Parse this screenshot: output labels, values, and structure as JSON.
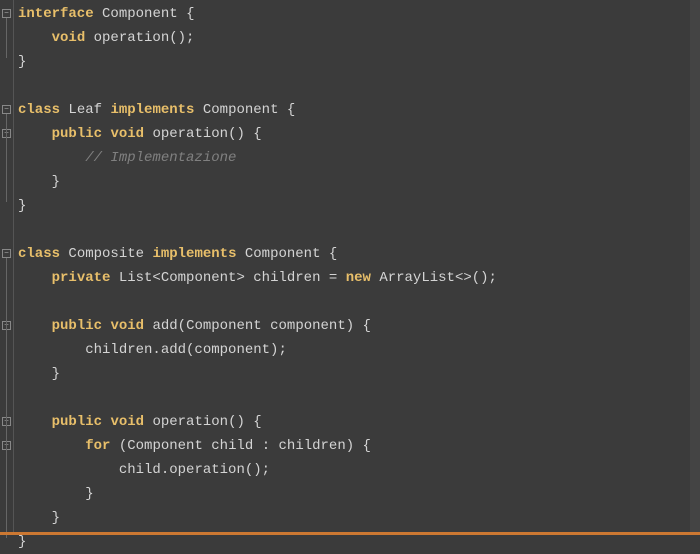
{
  "code": {
    "lines": [
      {
        "indent": 0,
        "tokens": [
          {
            "t": "kw",
            "v": "interface"
          },
          {
            "t": "sp",
            "v": " "
          },
          {
            "t": "type",
            "v": "Component"
          },
          {
            "t": "sp",
            "v": " "
          },
          {
            "t": "paren",
            "v": "{"
          }
        ]
      },
      {
        "indent": 1,
        "tokens": [
          {
            "t": "kw",
            "v": "void"
          },
          {
            "t": "sp",
            "v": " "
          },
          {
            "t": "method",
            "v": "operation"
          },
          {
            "t": "paren",
            "v": "();"
          }
        ]
      },
      {
        "indent": 0,
        "tokens": [
          {
            "t": "paren",
            "v": "}"
          }
        ]
      },
      {
        "indent": 0,
        "tokens": []
      },
      {
        "indent": 0,
        "tokens": [
          {
            "t": "kw",
            "v": "class"
          },
          {
            "t": "sp",
            "v": " "
          },
          {
            "t": "type",
            "v": "Leaf"
          },
          {
            "t": "sp",
            "v": " "
          },
          {
            "t": "kw",
            "v": "implements"
          },
          {
            "t": "sp",
            "v": " "
          },
          {
            "t": "type",
            "v": "Component"
          },
          {
            "t": "sp",
            "v": " "
          },
          {
            "t": "paren",
            "v": "{"
          }
        ]
      },
      {
        "indent": 1,
        "tokens": [
          {
            "t": "kw",
            "v": "public"
          },
          {
            "t": "sp",
            "v": " "
          },
          {
            "t": "kw",
            "v": "void"
          },
          {
            "t": "sp",
            "v": " "
          },
          {
            "t": "method",
            "v": "operation"
          },
          {
            "t": "paren",
            "v": "()"
          },
          {
            "t": "sp",
            "v": " "
          },
          {
            "t": "paren",
            "v": "{"
          }
        ]
      },
      {
        "indent": 2,
        "tokens": [
          {
            "t": "comment",
            "v": "// Implementazione"
          }
        ]
      },
      {
        "indent": 1,
        "tokens": [
          {
            "t": "paren",
            "v": "}"
          }
        ]
      },
      {
        "indent": 0,
        "tokens": [
          {
            "t": "paren",
            "v": "}"
          }
        ]
      },
      {
        "indent": 0,
        "tokens": []
      },
      {
        "indent": 0,
        "tokens": [
          {
            "t": "kw",
            "v": "class"
          },
          {
            "t": "sp",
            "v": " "
          },
          {
            "t": "type",
            "v": "Composite"
          },
          {
            "t": "sp",
            "v": " "
          },
          {
            "t": "kw",
            "v": "implements"
          },
          {
            "t": "sp",
            "v": " "
          },
          {
            "t": "type",
            "v": "Component"
          },
          {
            "t": "sp",
            "v": " "
          },
          {
            "t": "paren",
            "v": "{"
          }
        ]
      },
      {
        "indent": 1,
        "tokens": [
          {
            "t": "kw",
            "v": "private"
          },
          {
            "t": "sp",
            "v": " "
          },
          {
            "t": "type",
            "v": "List<Component>"
          },
          {
            "t": "sp",
            "v": " "
          },
          {
            "t": "name",
            "v": "children"
          },
          {
            "t": "sp",
            "v": " "
          },
          {
            "t": "op",
            "v": "="
          },
          {
            "t": "sp",
            "v": " "
          },
          {
            "t": "kw",
            "v": "new"
          },
          {
            "t": "sp",
            "v": " "
          },
          {
            "t": "type",
            "v": "ArrayList<>();"
          }
        ]
      },
      {
        "indent": 0,
        "tokens": []
      },
      {
        "indent": 1,
        "tokens": [
          {
            "t": "kw",
            "v": "public"
          },
          {
            "t": "sp",
            "v": " "
          },
          {
            "t": "kw",
            "v": "void"
          },
          {
            "t": "sp",
            "v": " "
          },
          {
            "t": "method",
            "v": "add"
          },
          {
            "t": "paren",
            "v": "("
          },
          {
            "t": "type",
            "v": "Component"
          },
          {
            "t": "sp",
            "v": " "
          },
          {
            "t": "name",
            "v": "component"
          },
          {
            "t": "paren",
            "v": ")"
          },
          {
            "t": "sp",
            "v": " "
          },
          {
            "t": "paren",
            "v": "{"
          }
        ]
      },
      {
        "indent": 2,
        "tokens": [
          {
            "t": "name",
            "v": "children.add(component);"
          }
        ]
      },
      {
        "indent": 1,
        "tokens": [
          {
            "t": "paren",
            "v": "}"
          }
        ]
      },
      {
        "indent": 0,
        "tokens": []
      },
      {
        "indent": 1,
        "tokens": [
          {
            "t": "kw",
            "v": "public"
          },
          {
            "t": "sp",
            "v": " "
          },
          {
            "t": "kw",
            "v": "void"
          },
          {
            "t": "sp",
            "v": " "
          },
          {
            "t": "method",
            "v": "operation"
          },
          {
            "t": "paren",
            "v": "()"
          },
          {
            "t": "sp",
            "v": " "
          },
          {
            "t": "paren",
            "v": "{"
          }
        ]
      },
      {
        "indent": 2,
        "tokens": [
          {
            "t": "kw",
            "v": "for"
          },
          {
            "t": "sp",
            "v": " "
          },
          {
            "t": "paren",
            "v": "("
          },
          {
            "t": "type",
            "v": "Component"
          },
          {
            "t": "sp",
            "v": " "
          },
          {
            "t": "name",
            "v": "child"
          },
          {
            "t": "sp",
            "v": " "
          },
          {
            "t": "op",
            "v": ":"
          },
          {
            "t": "sp",
            "v": " "
          },
          {
            "t": "name",
            "v": "children"
          },
          {
            "t": "paren",
            "v": ")"
          },
          {
            "t": "sp",
            "v": " "
          },
          {
            "t": "paren",
            "v": "{"
          }
        ]
      },
      {
        "indent": 3,
        "tokens": [
          {
            "t": "name",
            "v": "child.operation();"
          }
        ]
      },
      {
        "indent": 2,
        "tokens": [
          {
            "t": "paren",
            "v": "}"
          }
        ]
      },
      {
        "indent": 1,
        "tokens": [
          {
            "t": "paren",
            "v": "}"
          }
        ]
      },
      {
        "indent": 0,
        "tokens": [
          {
            "t": "paren",
            "v": "}"
          }
        ]
      }
    ],
    "foldMarks": [
      0,
      4,
      5,
      10,
      13,
      17,
      18
    ],
    "foldSymbol": "−"
  }
}
